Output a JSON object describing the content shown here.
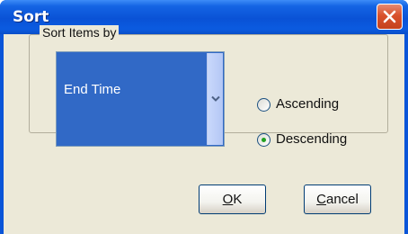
{
  "window": {
    "title": "Sort",
    "close_icon": "close-x-icon"
  },
  "group": {
    "legend": "Sort Items by"
  },
  "sort_field": {
    "selected": "End Time",
    "dropdown_icon": "chevron-down-icon"
  },
  "order": {
    "options": [
      {
        "label": "Ascending",
        "checked": false
      },
      {
        "label": "Descending",
        "checked": true
      }
    ]
  },
  "buttons": {
    "ok": {
      "mnemonic": "O",
      "rest": "K"
    },
    "cancel": {
      "mnemonic": "C",
      "rest": "ancel"
    }
  },
  "colors": {
    "titlebar": "#0a55d8",
    "close_button": "#d9512c",
    "selection": "#3169c6",
    "dialog_bg": "#ece9d8",
    "radio_dot": "#21a121"
  }
}
